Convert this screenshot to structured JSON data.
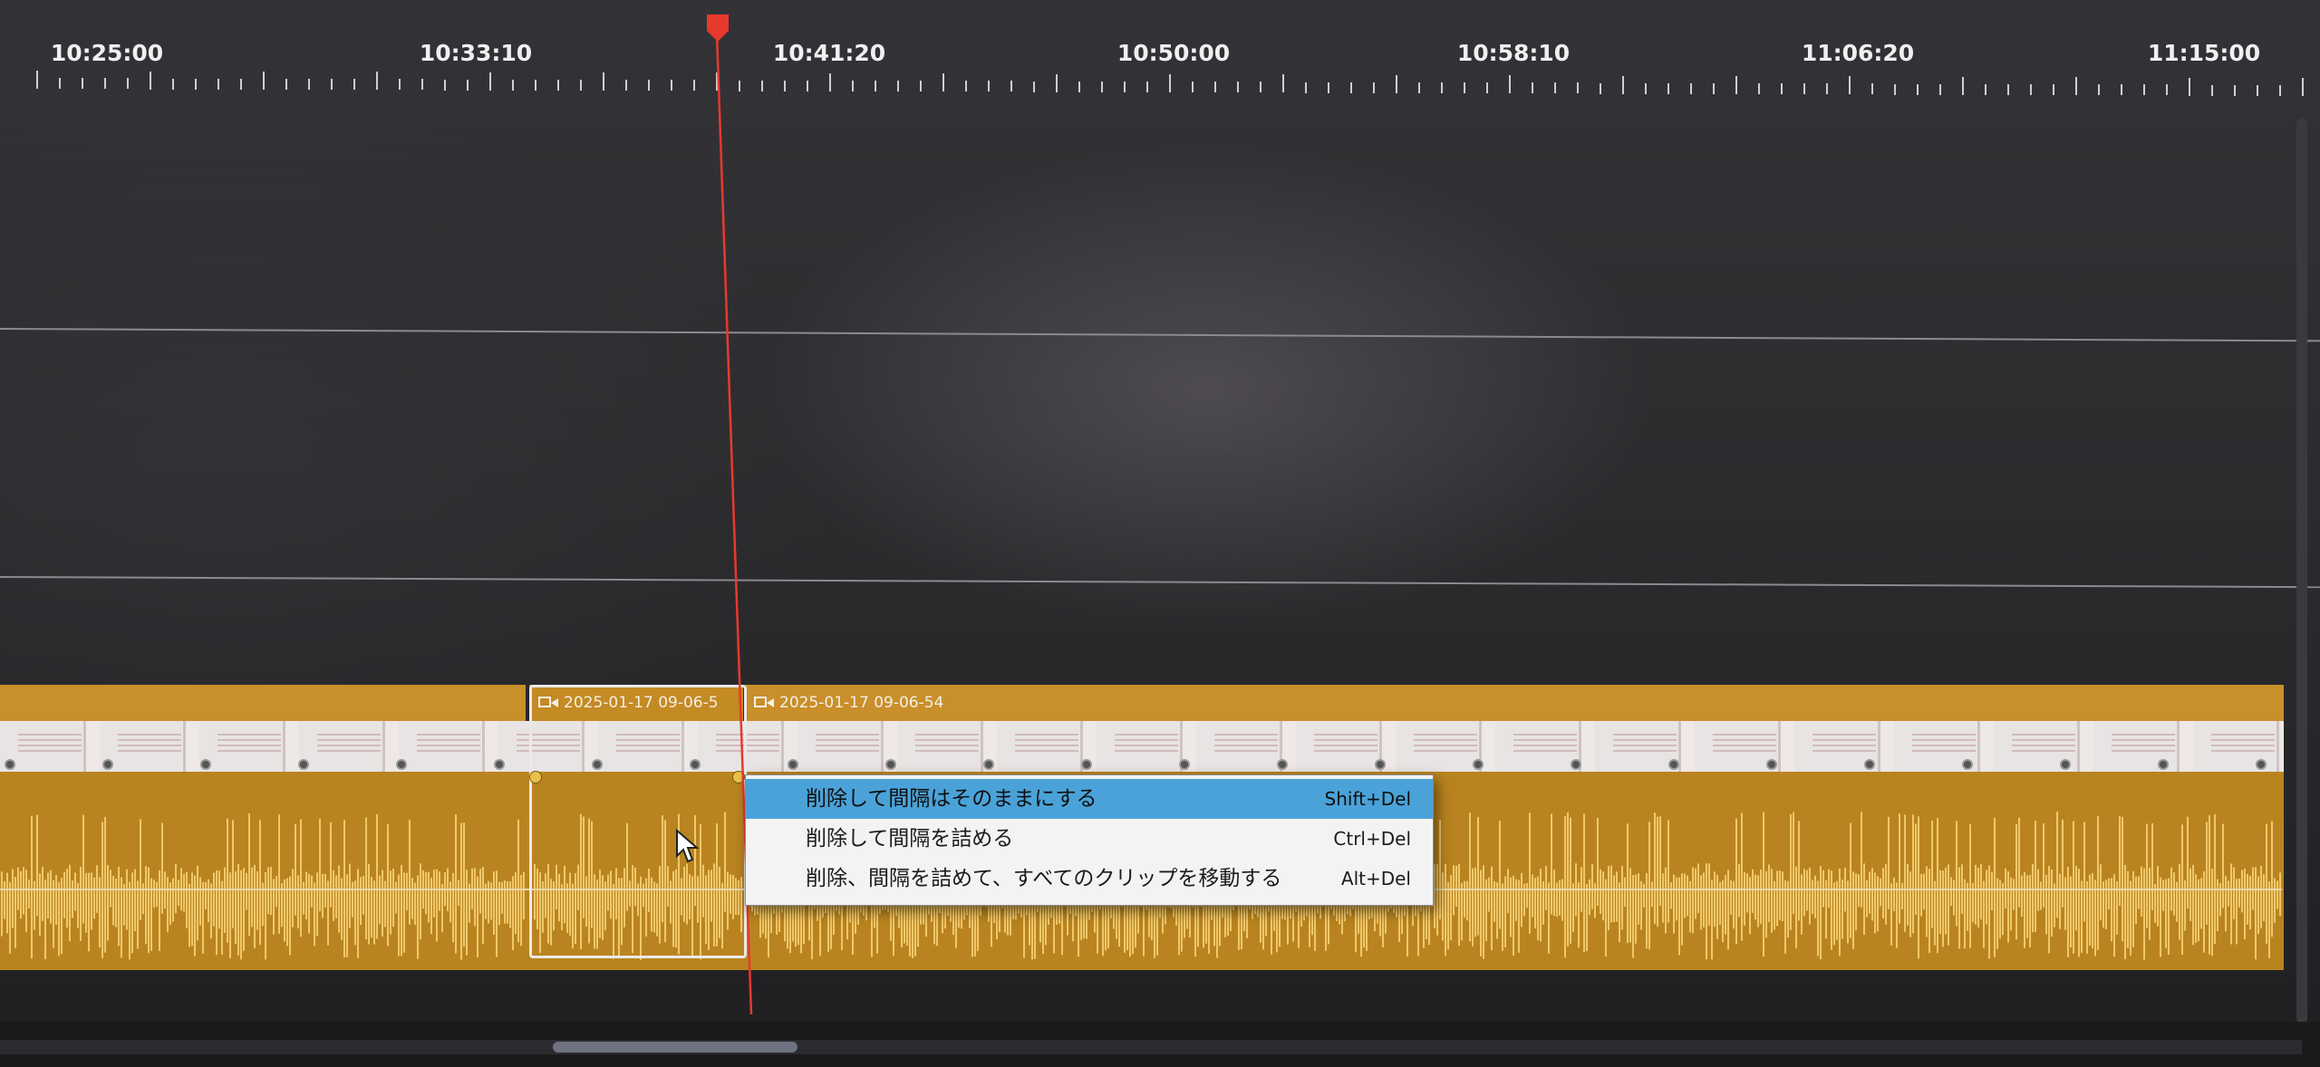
{
  "ruler": {
    "timecodes": [
      "10:25:00",
      "10:33:10",
      "10:41:20",
      "10:50:00",
      "10:58:10",
      "11:06:20",
      "11:15:00"
    ]
  },
  "track": {
    "clips": [
      {
        "name": ""
      },
      {
        "name": "2025-01-17 09-06-5"
      },
      {
        "name": "2025-01-17 09-06-54"
      }
    ]
  },
  "context_menu": {
    "items": [
      {
        "label": "削除して間隔はそのままにする",
        "shortcut": "Shift+Del"
      },
      {
        "label": "削除して間隔を詰める",
        "shortcut": "Ctrl+Del"
      },
      {
        "label": "削除、間隔を詰めて、すべてのクリップを移動する",
        "shortcut": "Alt+Del"
      }
    ]
  },
  "colors": {
    "clip_header": "#c98f2a",
    "audio_fill": "#b9841f",
    "waveform": "#f0c86a",
    "playhead": "#e8392d",
    "menu_highlight": "#4aa2d8"
  },
  "icons": {
    "clip_icon": "video-camera-icon",
    "playhead_icon": "playhead-marker-icon",
    "cursor": "mouse-pointer-icon"
  }
}
